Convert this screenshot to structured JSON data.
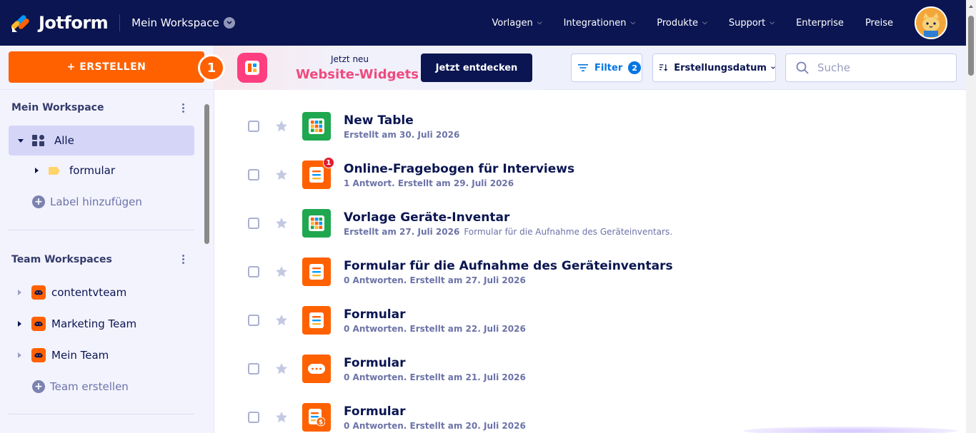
{
  "app": {
    "brand": "Jotform",
    "workspace_selector": "Mein Workspace"
  },
  "nav": {
    "items": [
      {
        "label": "Vorlagen",
        "has_caret": true
      },
      {
        "label": "Integrationen",
        "has_caret": true
      },
      {
        "label": "Produkte",
        "has_caret": true
      },
      {
        "label": "Support",
        "has_caret": true
      },
      {
        "label": "Enterprise",
        "has_caret": false
      },
      {
        "label": "Preise",
        "has_caret": false
      }
    ],
    "avatar_icon": "cat-avatar-icon"
  },
  "sidebar": {
    "create_label": "+ ERSTELLEN",
    "step_badge": "1",
    "my_workspace_heading": "Mein Workspace",
    "all_label": "Alle",
    "label_item": "formular",
    "add_label": "Label hinzufügen",
    "team_heading": "Team Workspaces",
    "teams": [
      "contentvteam",
      "Marketing Team",
      "Mein Team"
    ],
    "create_team": "Team erstellen"
  },
  "toolbar": {
    "promo_new": "Jetzt neu",
    "promo_title": "Website-Widgets",
    "promo_button": "Jetzt entdecken",
    "filter_label": "Filter",
    "filter_count": "2",
    "sort_label": "Erstellungsdatum",
    "search_placeholder": "Suche"
  },
  "forms": [
    {
      "title": "New Table",
      "meta": "Erstellt am 30. Juli 2026",
      "desc": "",
      "icon": "table-icon",
      "color": "#1fa84f",
      "badge": ""
    },
    {
      "title": "Online-Fragebogen für Interviews",
      "meta": "1 Antwort. Erstellt am 29. Juli 2026",
      "desc": "",
      "icon": "form-icon",
      "color": "#ff6100",
      "badge": "1"
    },
    {
      "title": "Vorlage Geräte-Inventar",
      "meta": "Erstellt am 27. Juli 2026",
      "desc": "Formular für die Aufnahme des Geräteinventars.",
      "icon": "table-icon",
      "color": "#1fa84f",
      "badge": ""
    },
    {
      "title": "Formular für die Aufnahme des Geräteinventars",
      "meta": "0 Antworten. Erstellt am 27. Juli 2026",
      "desc": "",
      "icon": "form-icon",
      "color": "#ff6100",
      "badge": ""
    },
    {
      "title": "Formular",
      "meta": "0 Antworten. Erstellt am 22. Juli 2026",
      "desc": "",
      "icon": "form-icon",
      "color": "#ff6100",
      "badge": ""
    },
    {
      "title": "Formular",
      "meta": "0 Antworten. Erstellt am 21. Juli 2026",
      "desc": "",
      "icon": "card-form-icon",
      "color": "#ff6100",
      "badge": ""
    },
    {
      "title": "Formular",
      "meta": "0 Antworten. Erstellt am 20. Juli 2026",
      "desc": "",
      "icon": "payment-form-icon",
      "color": "#ff6100",
      "badge": ""
    }
  ]
}
